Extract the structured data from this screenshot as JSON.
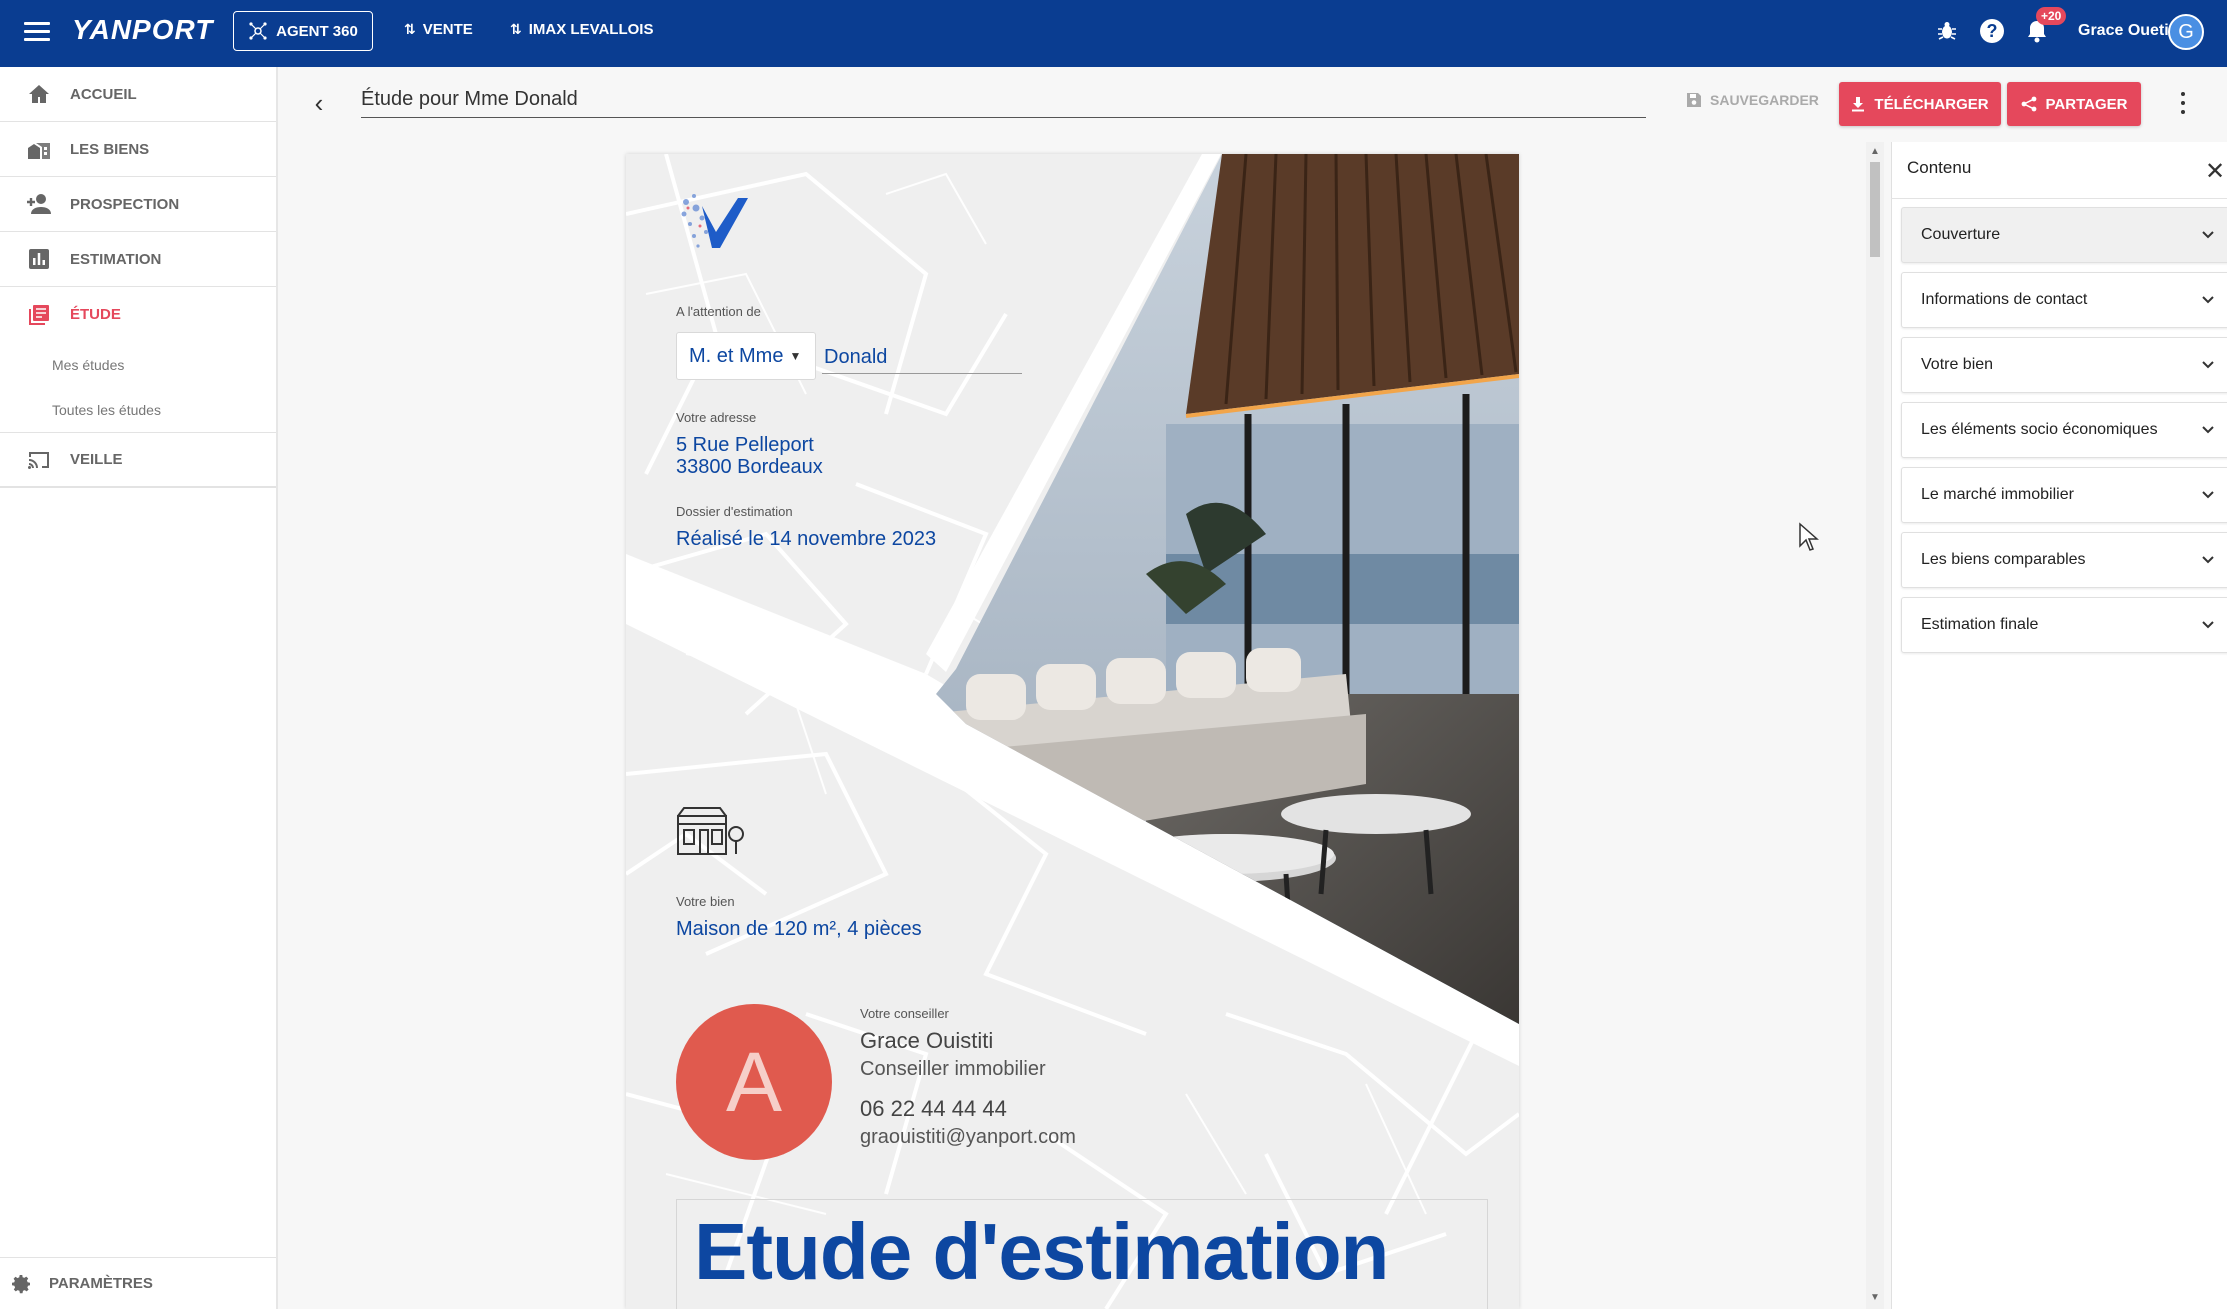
{
  "topbar": {
    "brand": "YANPORT",
    "agent_button": "AGENT 360",
    "nav": [
      "VENTE",
      "IMAX LEVALLOIS"
    ],
    "notification_count": "+20",
    "user_name": "Grace Oueti",
    "user_initial": "G",
    "bg_color": "#0a3d91"
  },
  "sidebar": {
    "items": [
      {
        "label": "ACCUEIL",
        "icon": "home-icon"
      },
      {
        "label": "LES BIENS",
        "icon": "buildings-icon"
      },
      {
        "label": "PROSPECTION",
        "icon": "person-add-icon"
      },
      {
        "label": "ESTIMATION",
        "icon": "bar-chart-icon"
      },
      {
        "label": "ÉTUDE",
        "icon": "document-stack-icon",
        "active": true
      },
      {
        "label": "VEILLE",
        "icon": "cast-icon"
      }
    ],
    "etude_sub": [
      "Mes études",
      "Toutes les études"
    ],
    "settings": "PARAMÈTRES",
    "active_color": "#e5485c"
  },
  "editor": {
    "title": "Étude pour Mme Donald",
    "save": "SAUVEGARDER",
    "download": "TÉLÉCHARGER",
    "share": "PARTAGER"
  },
  "document": {
    "attention_label": "A l'attention de",
    "civility": "M. et Mme",
    "name": "Donald",
    "address_label": "Votre adresse",
    "address_line1": "5 Rue Pelleport",
    "address_line2": "33800 Bordeaux",
    "dossier_label": "Dossier d'estimation",
    "dossier_value": "Réalisé le 14 novembre 2023",
    "property_label": "Votre bien",
    "property_value": "Maison de 120 m², 4 pièces",
    "advisor_label": "Votre conseiller",
    "advisor_name": "Grace Ouistiti",
    "advisor_role": "Conseiller immobilier",
    "advisor_phone": "06 22 44 44 44",
    "advisor_email": "graouistiti@yanport.com",
    "advisor_initial": "A",
    "heading": "Etude d'estimation",
    "accent_color": "#0d47a1"
  },
  "panel": {
    "title": "Contenu",
    "sections": [
      "Couverture",
      "Informations de contact",
      "Votre bien",
      "Les éléments socio économiques",
      "Le marché immobilier",
      "Les biens comparables",
      "Estimation finale"
    ]
  }
}
